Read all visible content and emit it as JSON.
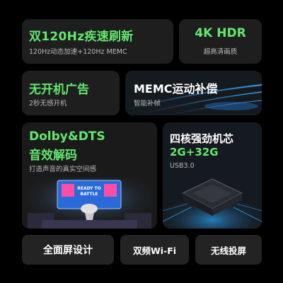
{
  "cards": {
    "refresh": {
      "title": "双120Hz疾速刷新",
      "subtitle": "120Hz动态加速+120Hz MEMC"
    },
    "hdr": {
      "title": "4K HDR",
      "subtitle": "超高清画质"
    },
    "noads": {
      "title": "无开机广告",
      "subtitle": "2秒无感开机"
    },
    "memc": {
      "title": "MEMC运动补偿",
      "subtitle": "智能补帧"
    },
    "audio": {
      "title_line1": "Dolby&DTS",
      "title_line2": "音效解码",
      "subtitle": "打造声音的真实空间感",
      "screen_text": "READY TO BATTLE"
    },
    "chip": {
      "title": "四核强劲机芯",
      "memory": "2G+32G",
      "usb": "USB3.0"
    }
  },
  "bottom": [
    "全面屏设计",
    "双频Wi-Fi",
    "无线投屏"
  ],
  "colors": {
    "accent": "#63e86e",
    "card_bg": "#1e1e1e",
    "page_bg": "#000000"
  }
}
